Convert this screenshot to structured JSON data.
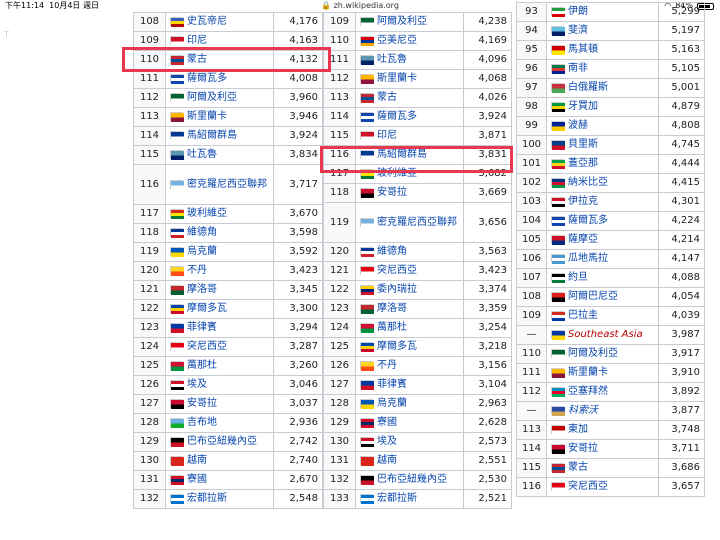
{
  "status_bar": {
    "time": "下午11:14",
    "date": "10月4日 週日",
    "url": "zh.wikipedia.org",
    "battery": "84%"
  },
  "page": {
    "left_marker": "T"
  },
  "colors": {
    "highlight": "#e8384f",
    "link": "#0645ad",
    "border": "#c8ccd1",
    "aggregate": "#ba0000"
  },
  "table1": [
    {
      "rank": "108",
      "name": "史瓦帝尼",
      "value": "4,176",
      "flag": "flag-eswatini",
      "flag_colors": [
        "#3e5eb9",
        "#ffd900",
        "#b10c0c"
      ]
    },
    {
      "rank": "109",
      "name": "印尼",
      "value": "4,163",
      "flag": "flag-indonesia",
      "flag_colors": [
        "#ce1126",
        "#ffffff"
      ],
      "highlight": true
    },
    {
      "rank": "110",
      "name": "蒙古",
      "value": "4,132",
      "flag": "flag-mongolia",
      "flag_colors": [
        "#c4272f",
        "#015197",
        "#c4272f"
      ]
    },
    {
      "rank": "111",
      "name": "薩爾瓦多",
      "value": "4,008",
      "flag": "flag-el-salvador",
      "flag_colors": [
        "#0f47af",
        "#ffffff",
        "#0f47af"
      ]
    },
    {
      "rank": "112",
      "name": "阿爾及利亞",
      "value": "3,960",
      "flag": "flag-algeria",
      "flag_colors": [
        "#006233",
        "#ffffff"
      ]
    },
    {
      "rank": "113",
      "name": "斯里蘭卡",
      "value": "3,946",
      "flag": "flag-sri-lanka",
      "flag_colors": [
        "#ffb700",
        "#8d153a"
      ]
    },
    {
      "rank": "114",
      "name": "馬紹爾群島",
      "value": "3,924",
      "flag": "flag-marshall-islands",
      "flag_colors": [
        "#003893",
        "#ffffff"
      ]
    },
    {
      "rank": "115",
      "name": "吐瓦魯",
      "value": "3,834",
      "flag": "flag-tuvalu",
      "flag_colors": [
        "#5b97b1",
        "#012169"
      ]
    },
    {
      "rank": "116",
      "name": "密克羅尼西亞聯邦",
      "value": "3,717",
      "flag": "flag-micronesia",
      "flag_colors": [
        "#75b2dd",
        "#ffffff"
      ],
      "tall": true
    },
    {
      "rank": "117",
      "name": "玻利維亞",
      "value": "3,670",
      "flag": "flag-bolivia",
      "flag_colors": [
        "#d52b1e",
        "#f9e300",
        "#007934"
      ]
    },
    {
      "rank": "118",
      "name": "維德角",
      "value": "3,598",
      "flag": "flag-cape-verde",
      "flag_colors": [
        "#003893",
        "#ffffff",
        "#cf2027"
      ]
    },
    {
      "rank": "119",
      "name": "烏克蘭",
      "value": "3,592",
      "flag": "flag-ukraine",
      "flag_colors": [
        "#0057b7",
        "#ffd700"
      ]
    },
    {
      "rank": "120",
      "name": "不丹",
      "value": "3,423",
      "flag": "flag-bhutan",
      "flag_colors": [
        "#ffd520",
        "#ff4e12"
      ]
    },
    {
      "rank": "121",
      "name": "摩洛哥",
      "value": "3,345",
      "flag": "flag-morocco",
      "flag_colors": [
        "#c1272d",
        "#006233"
      ]
    },
    {
      "rank": "122",
      "name": "摩爾多瓦",
      "value": "3,300",
      "flag": "flag-moldova",
      "flag_colors": [
        "#0046ae",
        "#ffd200",
        "#cc092f"
      ]
    },
    {
      "rank": "123",
      "name": "菲律賓",
      "value": "3,294",
      "flag": "flag-philippines",
      "flag_colors": [
        "#0038a8",
        "#ce1126"
      ]
    },
    {
      "rank": "124",
      "name": "突尼西亞",
      "value": "3,287",
      "flag": "flag-tunisia",
      "flag_colors": [
        "#e70013",
        "#ffffff"
      ]
    },
    {
      "rank": "125",
      "name": "萬那杜",
      "value": "3,260",
      "flag": "flag-vanuatu",
      "flag_colors": [
        "#d21034",
        "#009543"
      ]
    },
    {
      "rank": "126",
      "name": "埃及",
      "value": "3,046",
      "flag": "flag-egypt",
      "flag_colors": [
        "#ce1126",
        "#ffffff",
        "#000000"
      ]
    },
    {
      "rank": "127",
      "name": "安哥拉",
      "value": "3,037",
      "flag": "flag-angola",
      "flag_colors": [
        "#cc092f",
        "#000000"
      ]
    },
    {
      "rank": "128",
      "name": "吉布地",
      "value": "2,936",
      "flag": "flag-djibouti",
      "flag_colors": [
        "#6ab2e7",
        "#12ad2b"
      ]
    },
    {
      "rank": "129",
      "name": "巴布亞紐幾內亞",
      "value": "2,742",
      "flag": "flag-png",
      "flag_colors": [
        "#000000",
        "#ce1126"
      ]
    },
    {
      "rank": "130",
      "name": "越南",
      "value": "2,740",
      "flag": "flag-vietnam",
      "flag_colors": [
        "#da251d",
        "#da251d"
      ]
    },
    {
      "rank": "131",
      "name": "寮國",
      "value": "2,670",
      "flag": "flag-laos",
      "flag_colors": [
        "#ce1126",
        "#002868",
        "#ce1126"
      ]
    },
    {
      "rank": "132",
      "name": "宏都拉斯",
      "value": "2,548",
      "flag": "flag-honduras",
      "flag_colors": [
        "#0073cf",
        "#ffffff",
        "#0073cf"
      ]
    }
  ],
  "table2": [
    {
      "rank": "109",
      "name": "阿爾及利亞",
      "value": "4,238",
      "flag": "flag-algeria",
      "flag_colors": [
        "#006233",
        "#ffffff"
      ]
    },
    {
      "rank": "110",
      "name": "亞美尼亞",
      "value": "4,169",
      "flag": "flag-armenia",
      "flag_colors": [
        "#d90012",
        "#0033a0",
        "#f2a800"
      ]
    },
    {
      "rank": "111",
      "name": "吐瓦魯",
      "value": "4,096",
      "flag": "flag-tuvalu",
      "flag_colors": [
        "#5b97b1",
        "#012169"
      ]
    },
    {
      "rank": "112",
      "name": "斯里蘭卡",
      "value": "4,068",
      "flag": "flag-sri-lanka",
      "flag_colors": [
        "#ffb700",
        "#8d153a"
      ]
    },
    {
      "rank": "113",
      "name": "蒙古",
      "value": "4,026",
      "flag": "flag-mongolia",
      "flag_colors": [
        "#c4272f",
        "#015197",
        "#c4272f"
      ]
    },
    {
      "rank": "114",
      "name": "薩爾瓦多",
      "value": "3,924",
      "flag": "flag-el-salvador",
      "flag_colors": [
        "#0f47af",
        "#ffffff",
        "#0f47af"
      ]
    },
    {
      "rank": "115",
      "name": "印尼",
      "value": "3,871",
      "flag": "flag-indonesia",
      "flag_colors": [
        "#ce1126",
        "#ffffff"
      ],
      "highlight": true
    },
    {
      "rank": "116",
      "name": "馬紹爾群島",
      "value": "3,831",
      "flag": "flag-marshall-islands",
      "flag_colors": [
        "#003893",
        "#ffffff"
      ]
    },
    {
      "rank": "117",
      "name": "玻利維亞",
      "value": "3,682",
      "flag": "flag-bolivia",
      "flag_colors": [
        "#d52b1e",
        "#f9e300",
        "#007934"
      ]
    },
    {
      "rank": "118",
      "name": "安哥拉",
      "value": "3,669",
      "flag": "flag-angola",
      "flag_colors": [
        "#cc092f",
        "#000000"
      ]
    },
    {
      "rank": "119",
      "name": "密克羅尼西亞聯邦",
      "value": "3,656",
      "flag": "flag-micronesia",
      "flag_colors": [
        "#75b2dd",
        "#ffffff"
      ],
      "tall": true
    },
    {
      "rank": "120",
      "name": "維德角",
      "value": "3,563",
      "flag": "flag-cape-verde",
      "flag_colors": [
        "#003893",
        "#ffffff",
        "#cf2027"
      ]
    },
    {
      "rank": "121",
      "name": "突尼西亞",
      "value": "3,423",
      "flag": "flag-tunisia",
      "flag_colors": [
        "#e70013",
        "#ffffff"
      ]
    },
    {
      "rank": "122",
      "name": "委內瑞拉",
      "value": "3,374",
      "flag": "flag-venezuela",
      "flag_colors": [
        "#ffcc00",
        "#00247d",
        "#cf142b"
      ]
    },
    {
      "rank": "123",
      "name": "摩洛哥",
      "value": "3,359",
      "flag": "flag-morocco",
      "flag_colors": [
        "#c1272d",
        "#006233"
      ]
    },
    {
      "rank": "124",
      "name": "萬那杜",
      "value": "3,254",
      "flag": "flag-vanuatu",
      "flag_colors": [
        "#d21034",
        "#009543"
      ]
    },
    {
      "rank": "125",
      "name": "摩爾多瓦",
      "value": "3,218",
      "flag": "flag-moldova",
      "flag_colors": [
        "#0046ae",
        "#ffd200",
        "#cc092f"
      ]
    },
    {
      "rank": "126",
      "name": "不丹",
      "value": "3,156",
      "flag": "flag-bhutan",
      "flag_colors": [
        "#ffd520",
        "#ff4e12"
      ]
    },
    {
      "rank": "127",
      "name": "菲律賓",
      "value": "3,104",
      "flag": "flag-philippines",
      "flag_colors": [
        "#0038a8",
        "#ce1126"
      ]
    },
    {
      "rank": "128",
      "name": "烏克蘭",
      "value": "2,963",
      "flag": "flag-ukraine",
      "flag_colors": [
        "#0057b7",
        "#ffd700"
      ]
    },
    {
      "rank": "129",
      "name": "寮國",
      "value": "2,628",
      "flag": "flag-laos",
      "flag_colors": [
        "#ce1126",
        "#002868",
        "#ce1126"
      ]
    },
    {
      "rank": "130",
      "name": "埃及",
      "value": "2,573",
      "flag": "flag-egypt",
      "flag_colors": [
        "#ce1126",
        "#ffffff",
        "#000000"
      ]
    },
    {
      "rank": "131",
      "name": "越南",
      "value": "2,551",
      "flag": "flag-vietnam",
      "flag_colors": [
        "#da251d",
        "#da251d"
      ]
    },
    {
      "rank": "132",
      "name": "巴布亞紐幾內亞",
      "value": "2,530",
      "flag": "flag-png",
      "flag_colors": [
        "#000000",
        "#ce1126"
      ]
    },
    {
      "rank": "133",
      "name": "宏都拉斯",
      "value": "2,521",
      "flag": "flag-honduras",
      "flag_colors": [
        "#0073cf",
        "#ffffff",
        "#0073cf"
      ]
    }
  ],
  "table3": [
    {
      "rank": "93",
      "name": "伊朗",
      "value": "5,299",
      "flag": "flag-iran",
      "flag_colors": [
        "#239f40",
        "#ffffff",
        "#da0000"
      ]
    },
    {
      "rank": "94",
      "name": "斐濟",
      "value": "5,197",
      "flag": "flag-fiji",
      "flag_colors": [
        "#68bfe5",
        "#012169"
      ]
    },
    {
      "rank": "95",
      "name": "馬其頓",
      "value": "5,163",
      "flag": "flag-macedonia",
      "flag_colors": [
        "#d20000",
        "#ffe600"
      ]
    },
    {
      "rank": "96",
      "name": "南非",
      "value": "5,105",
      "flag": "flag-south-africa",
      "flag_colors": [
        "#007a4d",
        "#de3831",
        "#002395"
      ]
    },
    {
      "rank": "97",
      "name": "白俄羅斯",
      "value": "5,001",
      "flag": "flag-belarus",
      "flag_colors": [
        "#c8313e",
        "#4aa657"
      ]
    },
    {
      "rank": "98",
      "name": "牙買加",
      "value": "4,879",
      "flag": "flag-jamaica",
      "flag_colors": [
        "#009b3a",
        "#fed100",
        "#000000"
      ]
    },
    {
      "rank": "99",
      "name": "波赫",
      "value": "4,808",
      "flag": "flag-bosnia",
      "flag_colors": [
        "#002395",
        "#fecb00"
      ]
    },
    {
      "rank": "100",
      "name": "貝里斯",
      "value": "4,745",
      "flag": "flag-belize",
      "flag_colors": [
        "#003f87",
        "#ce1126"
      ]
    },
    {
      "rank": "101",
      "name": "蓋亞那",
      "value": "4,444",
      "flag": "flag-guyana",
      "flag_colors": [
        "#009e49",
        "#fcd116",
        "#ce1126"
      ]
    },
    {
      "rank": "102",
      "name": "納米比亞",
      "value": "4,415",
      "flag": "flag-namibia",
      "flag_colors": [
        "#003580",
        "#d21034",
        "#009543"
      ]
    },
    {
      "rank": "103",
      "name": "伊拉克",
      "value": "4,301",
      "flag": "flag-iraq",
      "flag_colors": [
        "#ce1126",
        "#ffffff",
        "#000000"
      ]
    },
    {
      "rank": "104",
      "name": "薩爾瓦多",
      "value": "4,224",
      "flag": "flag-el-salvador",
      "flag_colors": [
        "#0f47af",
        "#ffffff",
        "#0f47af"
      ]
    },
    {
      "rank": "105",
      "name": "薩摩亞",
      "value": "4,214",
      "flag": "flag-samoa",
      "flag_colors": [
        "#ce1126",
        "#002b7f"
      ]
    },
    {
      "rank": "106",
      "name": "瓜地馬拉",
      "value": "4,147",
      "flag": "flag-guatemala",
      "flag_colors": [
        "#4997d0",
        "#ffffff",
        "#4997d0"
      ]
    },
    {
      "rank": "107",
      "name": "約旦",
      "value": "4,088",
      "flag": "flag-jordan",
      "flag_colors": [
        "#000000",
        "#ffffff",
        "#007a3d"
      ]
    },
    {
      "rank": "108",
      "name": "阿爾巴尼亞",
      "value": "4,054",
      "flag": "flag-albania",
      "flag_colors": [
        "#e41e20",
        "#000000"
      ]
    },
    {
      "rank": "109",
      "name": "巴拉圭",
      "value": "4,039",
      "flag": "flag-paraguay",
      "flag_colors": [
        "#d52b1e",
        "#ffffff",
        "#0038a8"
      ]
    },
    {
      "rank": "—",
      "name": "Southeast Asia",
      "value": "3,987",
      "flag": "flag-asean",
      "flag_colors": [
        "#0039a6",
        "#ffd700"
      ],
      "aggregate": true
    },
    {
      "rank": "110",
      "name": "阿爾及利亞",
      "value": "3,917",
      "flag": "flag-algeria",
      "flag_colors": [
        "#006233",
        "#ffffff"
      ]
    },
    {
      "rank": "111",
      "name": "斯里蘭卡",
      "value": "3,910",
      "flag": "flag-sri-lanka",
      "flag_colors": [
        "#ffb700",
        "#8d153a"
      ]
    },
    {
      "rank": "112",
      "name": "亞塞拜然",
      "value": "3,892",
      "flag": "flag-azerbaijan",
      "flag_colors": [
        "#0092bc",
        "#e4002b",
        "#00af66"
      ]
    },
    {
      "rank": "—",
      "name": "科索沃",
      "value": "3,877",
      "flag": "flag-kosovo",
      "flag_colors": [
        "#244aa5",
        "#d0a650"
      ],
      "aggregate_plain": true
    },
    {
      "rank": "113",
      "name": "東加",
      "value": "3,748",
      "flag": "flag-tonga",
      "flag_colors": [
        "#c10000",
        "#ffffff"
      ]
    },
    {
      "rank": "114",
      "name": "安哥拉",
      "value": "3,711",
      "flag": "flag-angola",
      "flag_colors": [
        "#cc092f",
        "#000000"
      ]
    },
    {
      "rank": "115",
      "name": "蒙古",
      "value": "3,686",
      "flag": "flag-mongolia",
      "flag_colors": [
        "#c4272f",
        "#015197",
        "#c4272f"
      ]
    },
    {
      "rank": "116",
      "name": "突尼西亞",
      "value": "3,657",
      "flag": "flag-tunisia",
      "flag_colors": [
        "#e70013",
        "#ffffff"
      ]
    }
  ]
}
